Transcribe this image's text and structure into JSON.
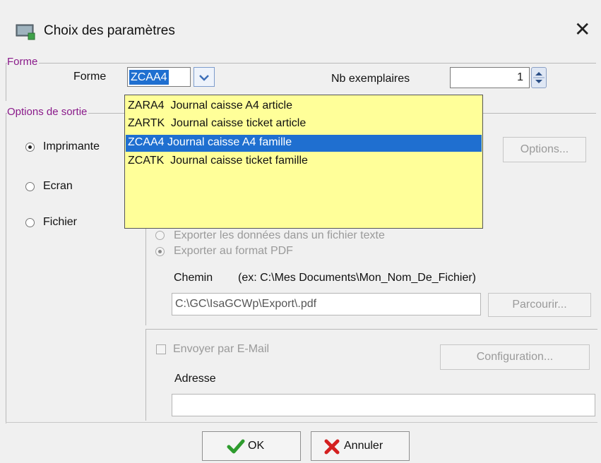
{
  "window": {
    "title": "Choix des paramètres",
    "close_glyph": "✕",
    "icon": "app-window-icon"
  },
  "forme_group": {
    "legend": "Forme",
    "forme_label": "Forme",
    "forme_value": "ZCAA4",
    "nb_label": "Nb exemplaires",
    "nb_value": "1",
    "dropdown_items": [
      {
        "text": "ZARA4  Journal caisse A4 article"
      },
      {
        "text": "ZARTK  Journal caisse ticket article"
      },
      {
        "text": "ZCAA4 Journal caisse A4 famille"
      },
      {
        "text": "ZCATK  Journal caisse ticket famille"
      }
    ],
    "selected_index": 2
  },
  "options_group": {
    "legend": "Options de sortie",
    "radios": [
      {
        "label": "Imprimante",
        "checked": true
      },
      {
        "label": "Ecran",
        "checked": false
      },
      {
        "label": "Fichier",
        "checked": false
      }
    ],
    "options_button": "Options..."
  },
  "file_options": {
    "export_text": "Exporter les données dans un fichier texte",
    "export_pdf": "Exporter au format PDF",
    "chemin_label": "Chemin",
    "chemin_hint": "(ex: C:\\Mes Documents\\Mon_Nom_De_Fichier)",
    "chemin_value": "C:\\GC\\IsaGCWp\\Export\\.pdf",
    "parcourir_button": "Parcourir..."
  },
  "email": {
    "send_label": "Envoyer par E-Mail",
    "configuration_button": "Configuration...",
    "adresse_label": "Adresse",
    "adresse_value": ""
  },
  "footer": {
    "ok_label": "OK",
    "cancel_label": "Annuler"
  },
  "colors": {
    "accent": "#1f6fd0",
    "dropdown_bg": "#ffff99",
    "legend": "#8a1a8a",
    "ok_check": "#2e9c2e",
    "cancel_x": "#d42020"
  }
}
